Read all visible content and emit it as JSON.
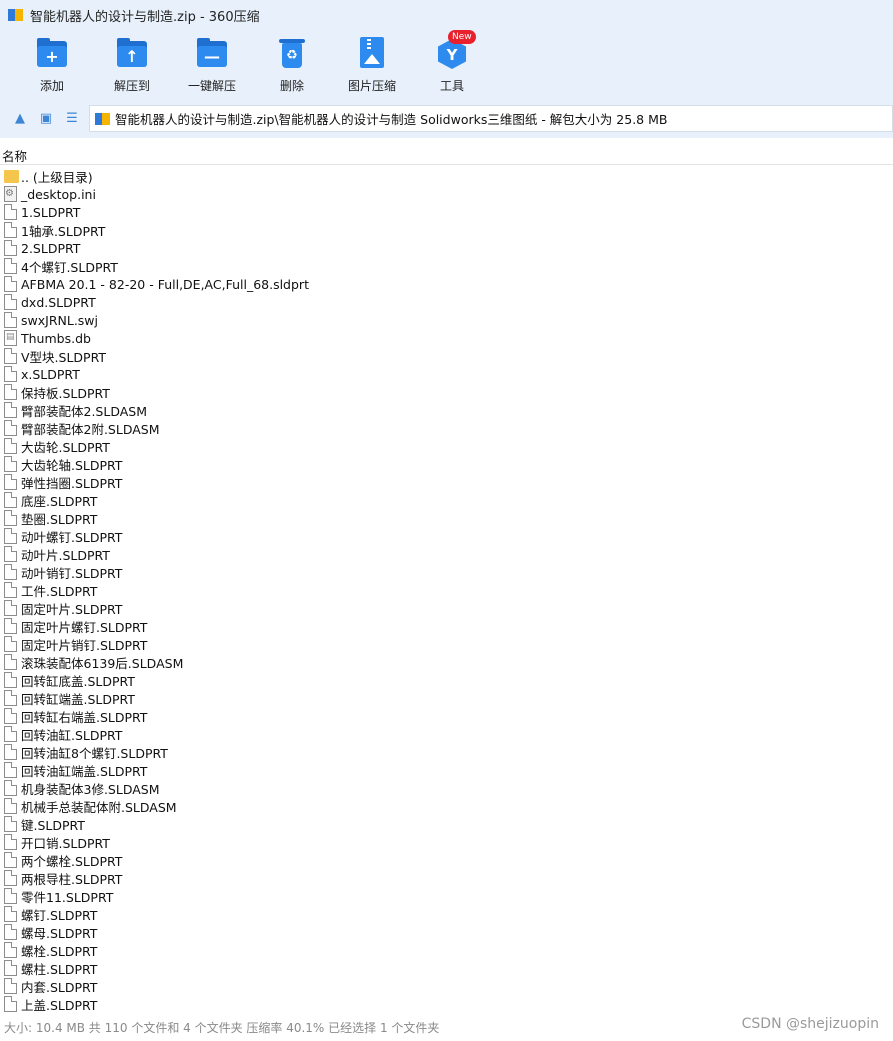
{
  "window": {
    "title": "智能机器人的设计与制造.zip - 360压缩"
  },
  "toolbar": {
    "buttons": [
      {
        "label": "添加",
        "icon": "add-icon"
      },
      {
        "label": "解压到",
        "icon": "extract-to-icon"
      },
      {
        "label": "一键解压",
        "icon": "one-click-extract-icon"
      },
      {
        "label": "删除",
        "icon": "delete-icon"
      },
      {
        "label": "图片压缩",
        "icon": "image-compress-icon"
      },
      {
        "label": "工具",
        "icon": "tools-icon"
      }
    ],
    "new_badge": "New"
  },
  "addressbar": {
    "path": "智能机器人的设计与制造.zip\\智能机器人的设计与制造 Solidworks三维图纸 - 解包大小为 25.8 MB",
    "icons": [
      "up-arrow-icon",
      "view-icon",
      "list-view-icon"
    ]
  },
  "columns": {
    "name": "名称"
  },
  "files": [
    {
      "name": ".. (上级目录)",
      "type": "folder"
    },
    {
      "name": "_desktop.ini",
      "type": "gear"
    },
    {
      "name": "1.SLDPRT",
      "type": "doc"
    },
    {
      "name": "1轴承.SLDPRT",
      "type": "doc"
    },
    {
      "name": "2.SLDPRT",
      "type": "doc"
    },
    {
      "name": "4个螺钉.SLDPRT",
      "type": "doc"
    },
    {
      "name": "AFBMA 20.1 - 82-20 - Full,DE,AC,Full_68.sldprt",
      "type": "doc"
    },
    {
      "name": "dxd.SLDPRT",
      "type": "doc"
    },
    {
      "name": "swxJRNL.swj",
      "type": "doc"
    },
    {
      "name": "Thumbs.db",
      "type": "db"
    },
    {
      "name": "V型块.SLDPRT",
      "type": "doc"
    },
    {
      "name": "x.SLDPRT",
      "type": "doc"
    },
    {
      "name": "保持板.SLDPRT",
      "type": "doc"
    },
    {
      "name": "臂部装配体2.SLDASM",
      "type": "doc"
    },
    {
      "name": "臂部装配体2附.SLDASM",
      "type": "doc"
    },
    {
      "name": "大齿轮.SLDPRT",
      "type": "doc"
    },
    {
      "name": "大齿轮轴.SLDPRT",
      "type": "doc"
    },
    {
      "name": "弹性挡圈.SLDPRT",
      "type": "doc"
    },
    {
      "name": "底座.SLDPRT",
      "type": "doc"
    },
    {
      "name": "垫圈.SLDPRT",
      "type": "doc"
    },
    {
      "name": "动叶螺钉.SLDPRT",
      "type": "doc"
    },
    {
      "name": "动叶片.SLDPRT",
      "type": "doc"
    },
    {
      "name": "动叶销钉.SLDPRT",
      "type": "doc"
    },
    {
      "name": "工件.SLDPRT",
      "type": "doc"
    },
    {
      "name": "固定叶片.SLDPRT",
      "type": "doc"
    },
    {
      "name": "固定叶片螺钉.SLDPRT",
      "type": "doc"
    },
    {
      "name": "固定叶片销钉.SLDPRT",
      "type": "doc"
    },
    {
      "name": "滚珠装配体6139后.SLDASM",
      "type": "doc"
    },
    {
      "name": "回转缸底盖.SLDPRT",
      "type": "doc"
    },
    {
      "name": "回转缸端盖.SLDPRT",
      "type": "doc"
    },
    {
      "name": "回转缸右端盖.SLDPRT",
      "type": "doc"
    },
    {
      "name": "回转油缸.SLDPRT",
      "type": "doc"
    },
    {
      "name": "回转油缸8个螺钉.SLDPRT",
      "type": "doc"
    },
    {
      "name": "回转油缸端盖.SLDPRT",
      "type": "doc"
    },
    {
      "name": "机身装配体3修.SLDASM",
      "type": "doc"
    },
    {
      "name": "机械手总装配体附.SLDASM",
      "type": "doc"
    },
    {
      "name": "键.SLDPRT",
      "type": "doc"
    },
    {
      "name": "开口销.SLDPRT",
      "type": "doc"
    },
    {
      "name": "两个螺栓.SLDPRT",
      "type": "doc"
    },
    {
      "name": "两根导柱.SLDPRT",
      "type": "doc"
    },
    {
      "name": "零件11.SLDPRT",
      "type": "doc"
    },
    {
      "name": "螺钉.SLDPRT",
      "type": "doc"
    },
    {
      "name": "螺母.SLDPRT",
      "type": "doc"
    },
    {
      "name": "螺栓.SLDPRT",
      "type": "doc"
    },
    {
      "name": "螺柱.SLDPRT",
      "type": "doc"
    },
    {
      "name": "内套.SLDPRT",
      "type": "doc"
    },
    {
      "name": "上盖.SLDPRT",
      "type": "doc"
    }
  ],
  "status": {
    "text": "大小: 10.4 MB 共 110 个文件和 4 个文件夹 压缩率 40.1% 已经选择 1 个文件夹",
    "watermark": "CSDN @shejizuopin"
  }
}
